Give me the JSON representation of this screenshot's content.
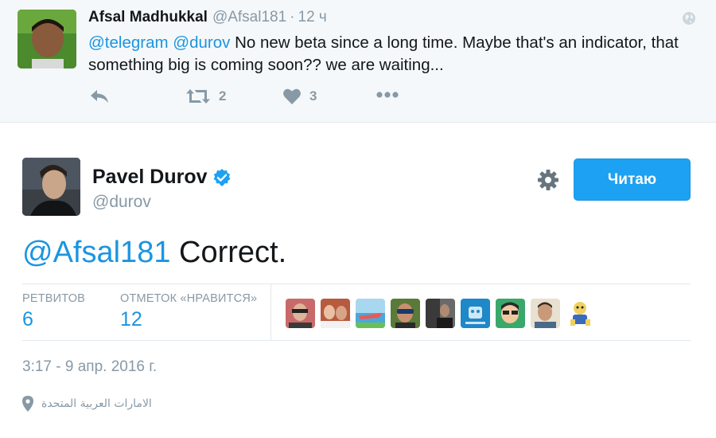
{
  "parent_tweet": {
    "author_name": "Afsal Madhukkal",
    "author_handle": "@Afsal181",
    "separator": "·",
    "time": "12 ч",
    "mention_1": "@telegram",
    "mention_2": "@durov",
    "text": "No new beta since a long time. Maybe that's an indicator, that something big is coming soon?? we are waiting...",
    "retweet_count": "2",
    "like_count": "3",
    "icons": [
      "globe-icon",
      "reply-icon",
      "retweet-icon",
      "heart-icon",
      "more-icon"
    ]
  },
  "main_tweet": {
    "author_name": "Pavel Durov",
    "author_handle": "@durov",
    "follow_button_label": "Читаю",
    "mention": "@Afsal181",
    "text": "Correct.",
    "retweets_label": "РЕТВИТОВ",
    "retweets_value": "6",
    "likes_label": "ОТМЕТОК «НРАВИТСЯ»",
    "likes_value": "12",
    "likers_count_shown": 9,
    "timestamp": "3:17 - 9 апр. 2016 г.",
    "location": "الامارات العربية المتحدة",
    "icons": [
      "verified-badge-icon",
      "gear-icon",
      "location-pin-icon"
    ]
  },
  "colors": {
    "accent": "#1da1f2",
    "link": "#1b95e0",
    "muted": "#8899a6",
    "text": "#14171a",
    "parent_bg": "#f5f8fa"
  }
}
